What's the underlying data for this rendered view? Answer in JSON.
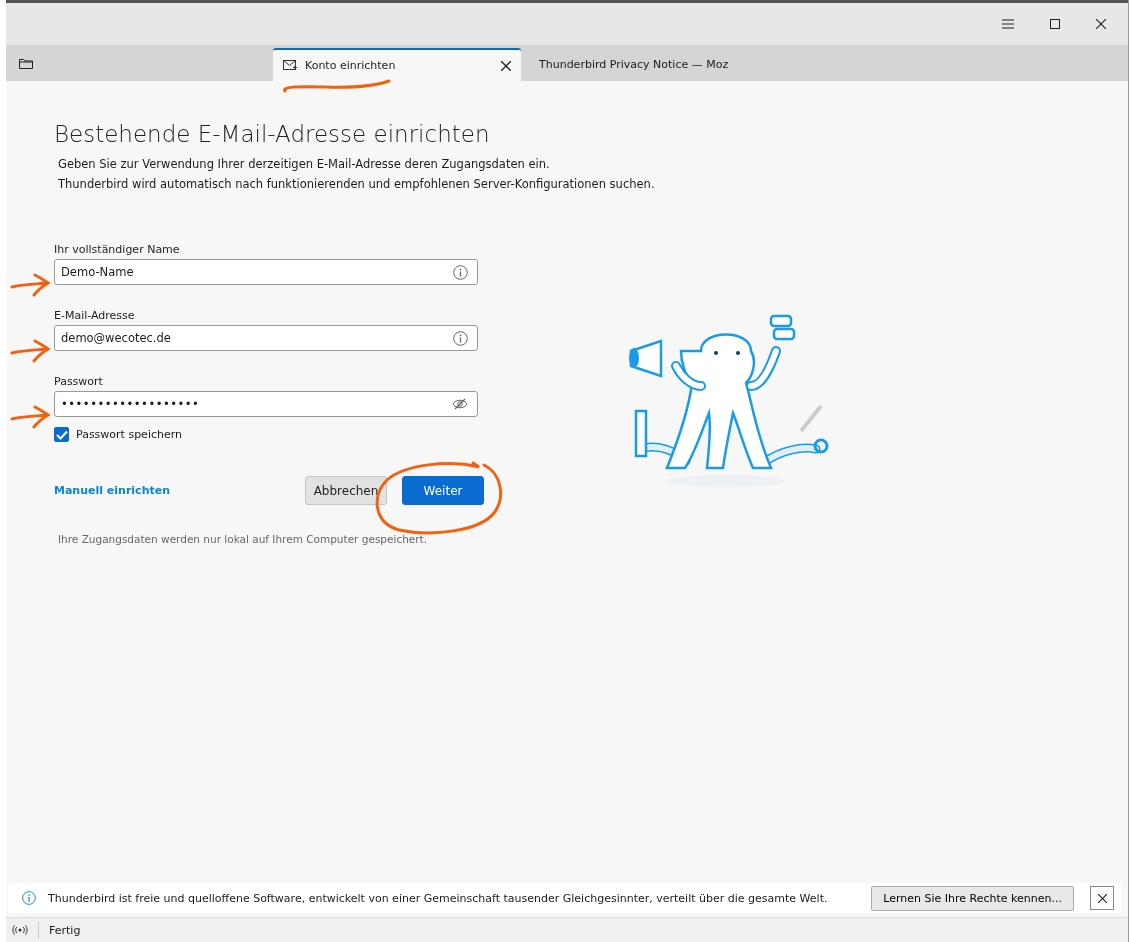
{
  "tabs": [
    {
      "label": "Konto einrichten",
      "kind": "mail",
      "selected": true
    },
    {
      "label": "Thunderbird Privacy Notice — Moz",
      "kind": "web",
      "selected": false
    }
  ],
  "heading": "Bestehende E-Mail-Adresse einrichten",
  "intro": [
    "Geben Sie zur Verwendung Ihrer derzeitigen E-Mail-Adresse deren Zugangsdaten ein.",
    "Thunderbird wird automatisch nach funktionierenden und empfohlenen Server-Konfigurationen suchen."
  ],
  "fields": [
    {
      "label": "Ihr vollständiger Name",
      "value": "Demo-Name",
      "kind": "info"
    },
    {
      "label": "E-Mail-Adresse",
      "value": "demo@wecotec.de",
      "kind": "info"
    },
    {
      "label": "Passwort",
      "value": "•••••••••••••••••••",
      "kind": "password"
    }
  ],
  "remember": {
    "label": "Passwort speichern",
    "checked": true
  },
  "manual_link": "Manuell einrichten",
  "buttons": [
    {
      "label": "Abbrechen",
      "kind": "secondary"
    },
    {
      "label": "Weiter",
      "kind": "primary"
    }
  ],
  "privacy_note": "Ihre Zugangsdaten werden nur lokal auf Ihrem Computer gespeichert.",
  "notification": {
    "text": "Thunderbird ist freie und quelloffene Software, entwickelt von einer Gemeinschaft tausender Gleichgesinnter, verteilt über die gesamte Welt.",
    "button": "Lernen Sie Ihre Rechte kennen..."
  },
  "status_bar": {
    "text": "Fertig"
  }
}
